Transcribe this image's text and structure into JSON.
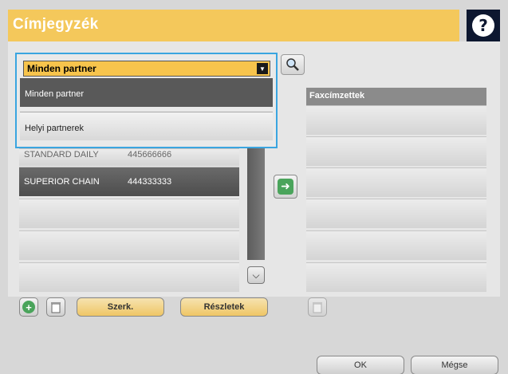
{
  "header": {
    "title": "Címjegyzék",
    "help_icon": "question-mark-icon"
  },
  "dropdown": {
    "selected": "Minden partner",
    "options": [
      "Minden partner",
      "Helyi partnerek"
    ]
  },
  "contacts": [
    {
      "name": "STANDARD DAILY",
      "number": "445666666",
      "partial": true
    },
    {
      "name": "SUPERIOR CHAIN",
      "number": "444333333"
    }
  ],
  "fax_recipients": {
    "header": "Faxcímzettek"
  },
  "buttons": {
    "edit": "Szerk.",
    "details": "Részletek",
    "ok": "OK",
    "cancel": "Mégse"
  },
  "colors": {
    "accent": "#f4c85b",
    "highlight": "#3aa5e0",
    "selected_row": "#595959"
  }
}
